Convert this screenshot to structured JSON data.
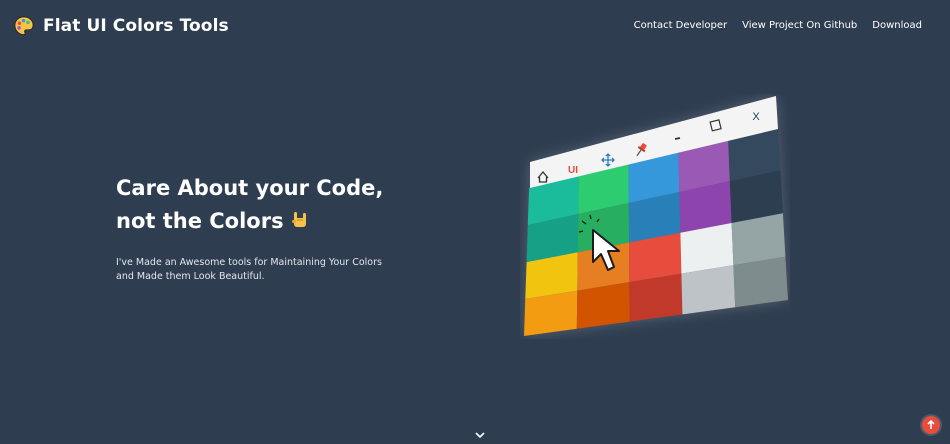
{
  "header": {
    "title": "Flat UI Colors Tools",
    "logo_icon": "palette-icon",
    "nav": [
      {
        "label": "Contact Developer"
      },
      {
        "label": "View Project On Github"
      },
      {
        "label": "Download"
      }
    ]
  },
  "hero": {
    "headline_line1": "Care About your Code,",
    "headline_line2": "not the Colors",
    "headline_emoji": "rock-on-hand-icon",
    "subtext": "I've Made an Awesome tools for Maintaining Your Colors and Made them Look Beautiful."
  },
  "illustration": {
    "toolbar_label": "UI",
    "window_close_label": "X",
    "toolbar_icons": [
      "home-icon",
      "ui-icon",
      "move-icon",
      "pin-icon",
      "minimize-icon",
      "maximize-icon",
      "close-icon"
    ],
    "swatch_colors": [
      [
        "#1abc9c",
        "#2ecc71",
        "#3498db",
        "#9b59b6",
        "#34495e"
      ],
      [
        "#16a085",
        "#27ae60",
        "#2980b9",
        "#8e44ad",
        "#2c3e50"
      ],
      [
        "#f1c40f",
        "#e67e22",
        "#e74c3c",
        "#ecf0f1",
        "#95a5a6"
      ],
      [
        "#f39c12",
        "#d35400",
        "#c0392b",
        "#bdc3c7",
        "#7f8c8d"
      ]
    ]
  },
  "colors": {
    "background": "#2f3d51",
    "back_to_top": "#e74c3c"
  },
  "footer": {
    "scroll_icon": "chevron-down-icon",
    "back_to_top_icon": "arrow-up-icon"
  }
}
